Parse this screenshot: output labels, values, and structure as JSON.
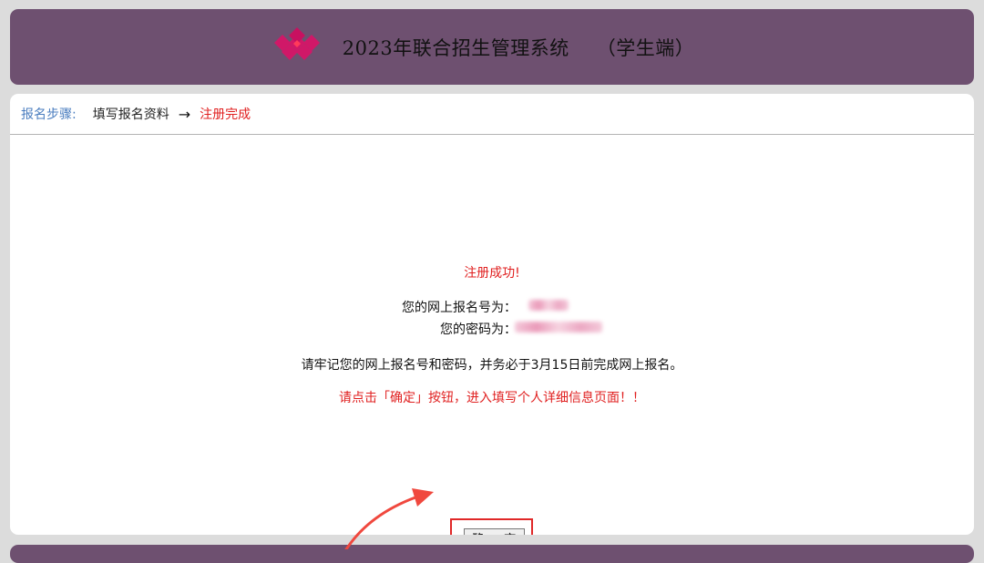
{
  "header": {
    "title": "2023年联合招生管理系统",
    "subtitle": "（学生端）"
  },
  "steps": {
    "label": "报名步骤:",
    "step1": "填写报名资料",
    "arrow": "→",
    "current": "注册完成"
  },
  "result": {
    "success": "注册成功!",
    "reg_no_label": "您的网上报名号为：",
    "password_label": "您的密码为：",
    "reminder": "请牢记您的网上报名号和密码，并务必于3月15日前完成网上报名。",
    "instruction": "请点击「确定」按钮，进入填写个人详细信息页面！！"
  },
  "confirm_button": "确 定",
  "colors": {
    "header_bg": "#6e5070",
    "accent_red": "#e02020",
    "label_blue": "#4a7dbf",
    "logo_pink": "#d01868"
  }
}
